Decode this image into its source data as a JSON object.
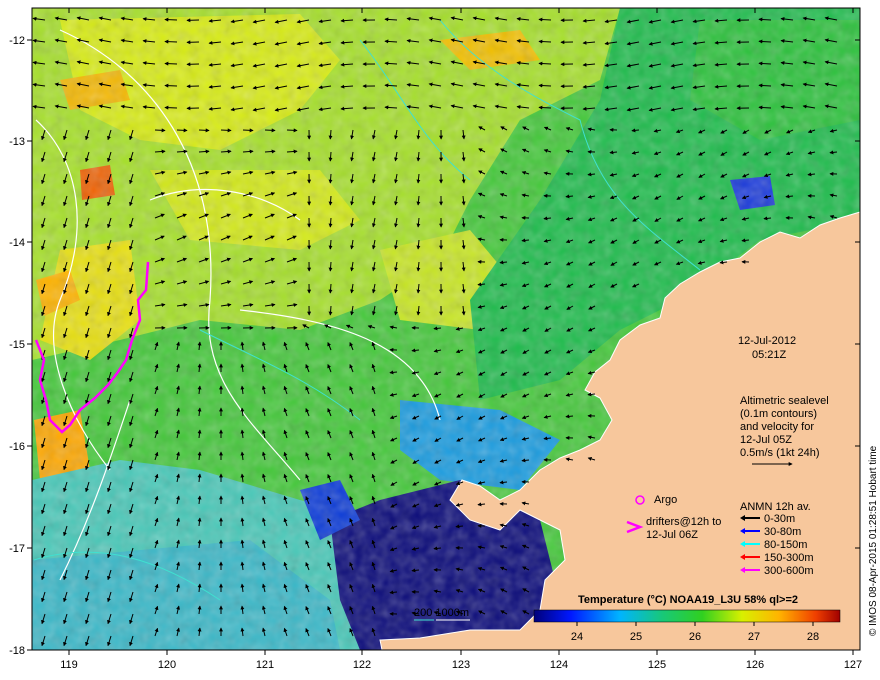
{
  "map": {
    "lon_ticks": [
      "119",
      "120",
      "121",
      "122",
      "123",
      "124",
      "125",
      "126",
      "127"
    ],
    "lat_ticks": [
      "-12",
      "-13",
      "-14",
      "-15",
      "-16",
      "-17",
      "-18"
    ],
    "date_label": "12-Jul-2012",
    "time_label": "05:21Z",
    "altimetry_note": [
      "Altimetric sealevel",
      "(0.1m contours)",
      "and velocity for",
      "12-Jul 05Z",
      "0.5m/s (1kt 24h)"
    ],
    "argo_label": "Argo",
    "drifters_note": [
      "drifters@12h to",
      "12-Jul 06Z"
    ],
    "anmn_title": "ANMN 12h av.",
    "anmn_legend": [
      {
        "label": "0-30m",
        "color": "#000000"
      },
      {
        "label": "30-80m",
        "color": "#0000ff"
      },
      {
        "label": "80-150m",
        "color": "#00ffff"
      },
      {
        "label": "150-300m",
        "color": "#ff0000"
      },
      {
        "label": "300-600m",
        "color": "#ff00ff"
      }
    ],
    "depth_contour_label": "200  1000m",
    "colorbar": {
      "title": "Temperature (°C) NOAA19_L3U 58% ql>=2",
      "ticks": [
        "24",
        "25",
        "26",
        "27",
        "28"
      ]
    },
    "credit": "© IMOS 08-Apr-2015 01:28:51 Hobart time",
    "colors": {
      "land": "#f7c79c",
      "deep_cold": "#0a0a7a",
      "drifter": "#ff00ff",
      "contour": "#ffffff",
      "shelf_contour": "#40e0d0"
    }
  }
}
